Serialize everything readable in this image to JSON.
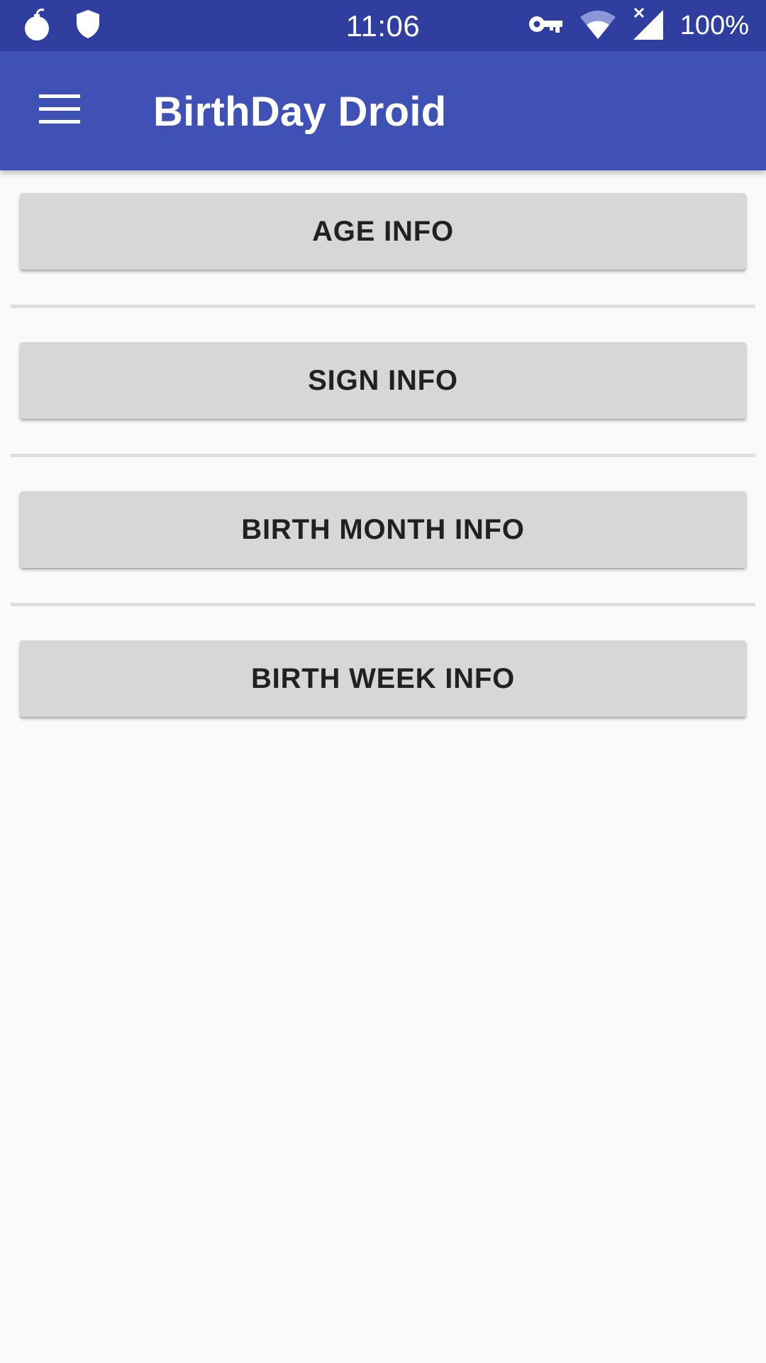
{
  "status_bar": {
    "time": "11:06",
    "battery": "100%",
    "icons": [
      "bomb-icon",
      "shield-icon",
      "vpn-key-icon",
      "wifi-icon",
      "signal-no-data-icon"
    ]
  },
  "app_bar": {
    "title": "BirthDay Droid",
    "menu_icon": "hamburger-menu-icon",
    "background": "#3f51b5",
    "status_background": "#303f9f"
  },
  "buttons": {
    "age_info": "AGE INFO",
    "sign_info": "SIGN INFO",
    "birth_month_info": "BIRTH MONTH INFO",
    "birth_week_info": "BIRTH WEEK INFO"
  }
}
